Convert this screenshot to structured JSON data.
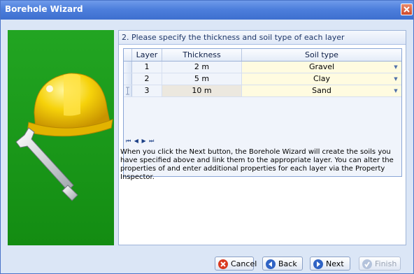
{
  "window": {
    "title": "Borehole Wizard"
  },
  "step": {
    "heading": "2. Please specify the thickness and soil type of each layer"
  },
  "grid": {
    "columns": [
      "Layer",
      "Thickness",
      "Soil type"
    ],
    "rows": [
      {
        "layer": "1",
        "thickness": "2 m",
        "soil": "Gravel"
      },
      {
        "layer": "2",
        "thickness": "5 m",
        "soil": "Clay"
      },
      {
        "layer": "3",
        "thickness": "10 m",
        "soil": "Sand"
      }
    ],
    "nav": "⏮ ◀ ▶ ⏭"
  },
  "description": "When you click the Next button, the Borehole Wizard will create the soils you have specified above and link them to the appropriate layer. You can alter the properties of and enter additional properties for each layer via the Property Inspector.",
  "buttons": {
    "cancel": "Cancel",
    "back": "Back",
    "next": "Next",
    "finish": "Finish"
  },
  "icons": {
    "close": "close-icon",
    "hardhat": "hardhat-wrench-icon",
    "cancel": "cancel-icon",
    "back": "back-arrow-icon",
    "next": "next-arrow-icon",
    "finish": "finish-icon"
  },
  "colors": {
    "accent": "#3e6fcf",
    "panel_green": "#1a9a19",
    "soil_cell": "#fffbe0"
  }
}
